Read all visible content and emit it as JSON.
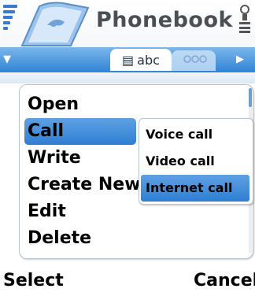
{
  "app": {
    "title": "Phonebook"
  },
  "tabs": {
    "active_label": "abc"
  },
  "menu": {
    "items": [
      "Open",
      "Call",
      "Write",
      "Create New",
      "Edit",
      "Delete"
    ],
    "selected_index": 1
  },
  "submenu": {
    "items": [
      "Voice call",
      "Video call",
      "Internet call"
    ],
    "selected_index": 2
  },
  "softkeys": {
    "left": "Select",
    "right": "Cancel"
  },
  "colors": {
    "accent": "#2f7fd3",
    "tab_bar": "#4a96df"
  }
}
